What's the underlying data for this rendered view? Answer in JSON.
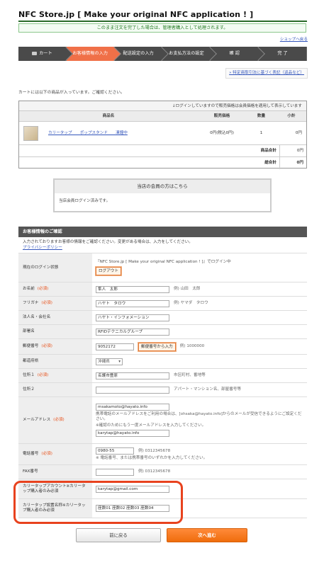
{
  "site_title": "NFC Store.jp [ Make your original NFC application ! ]",
  "notice": "このまま注文を完了した場合は、管理者購入として処理されます。",
  "back_to_shop": "ショップへ戻る",
  "steps": [
    "カート",
    "お客様情報の入力",
    "配送設定の入力",
    "お支払方法の設定",
    "確 認",
    "完 了"
  ],
  "active_step": 1,
  "law_link": "» 特定商取引法に基づく表記（返品など）",
  "cart_intro": "カートには以下の商品が入っています。ご確認ください。",
  "cart": {
    "note": "↓ログインしていますので販売価格は会員価格を適用して表示しています",
    "headers": [
      "商品名",
      "販売価格",
      "数量",
      "小計"
    ],
    "item": {
      "name": "カリータップ　　ポップスタンド　　凍鐘中",
      "price": "0円(税込0円)",
      "qty": "1",
      "subtotal": "0円"
    },
    "product_total_label": "商品合計",
    "product_total": "0円",
    "grand_total_label": "総合計",
    "grand_total": "0円"
  },
  "member": {
    "title": "当店の会員の方はこちら",
    "status": "当店会員ログイン済みです。"
  },
  "form": {
    "title": "お客様情報のご確認",
    "intro": "入力されておりますお客様の情報をご確認ください。変更がある場合は、入力をしてください。",
    "privacy": "プライバシーポリシー",
    "required": "(必須)",
    "login_label": "現在のログイン状態",
    "login_text": "『NFC Store.jp [ Make your original NFC application ! ]』でログイン中",
    "logout": "ログアウト",
    "name_label": "お名前",
    "name_value": "隼人　太郎",
    "name_hint": "例) 山田　太郎",
    "kana_label": "フリガナ",
    "kana_value": "ハヤト　タロウ",
    "kana_hint": "例) ヤマダ　タロウ",
    "company_label": "法人名・会社名",
    "company_value": "ハヤト・インフォメーション",
    "dept_label": "部署名",
    "dept_value": "RFIDテクニカルグループ",
    "zip_label": "郵便番号",
    "zip_value": "9052172",
    "zip_button": "郵便番号から入力",
    "zip_hint": "例) 1000000",
    "pref_label": "都道府県",
    "pref_value": "沖縄県",
    "addr1_label": "住所１",
    "addr1_value": "名護市豊原",
    "addr1_hint": "市区町村、番地等",
    "addr2_label": "住所２",
    "addr2_value": "",
    "addr2_hint": "アパート・マンション名、部屋番号等",
    "mail_label": "メールアドレス",
    "mail_value": "msakamoto@hayato.info",
    "mail_note": "携帯電話のメールアドレスをご利用の場合は、[ohsaka@hayato.info]からのメールが受信できるようにご設定ください。",
    "mail_confirm_note": "※確認のためにもう一度メールアドレスを入力してください。",
    "mail_confirm_value": "karytap@hayato.info",
    "tel_label": "電話番号",
    "tel_value": "0980-55",
    "tel_hint": "例) 0312345678",
    "tel_note": "※ 電話番号、または携帯番号のいずれかを入力してください。",
    "fax_label": "FAX番号",
    "fax_value": "",
    "fax_hint": "例) 0312345678",
    "acct_label": "カリータップアカウント※カリータップ購入者のみ必須",
    "acct_value": "karytap@gmail.com",
    "station_label": "カリータップ設置名称※カリータップ購入者のみ必須",
    "station_value": "座数01 座数02 座数03 座数04"
  },
  "buttons": {
    "back": "前に戻る",
    "next": "次へ進む"
  }
}
